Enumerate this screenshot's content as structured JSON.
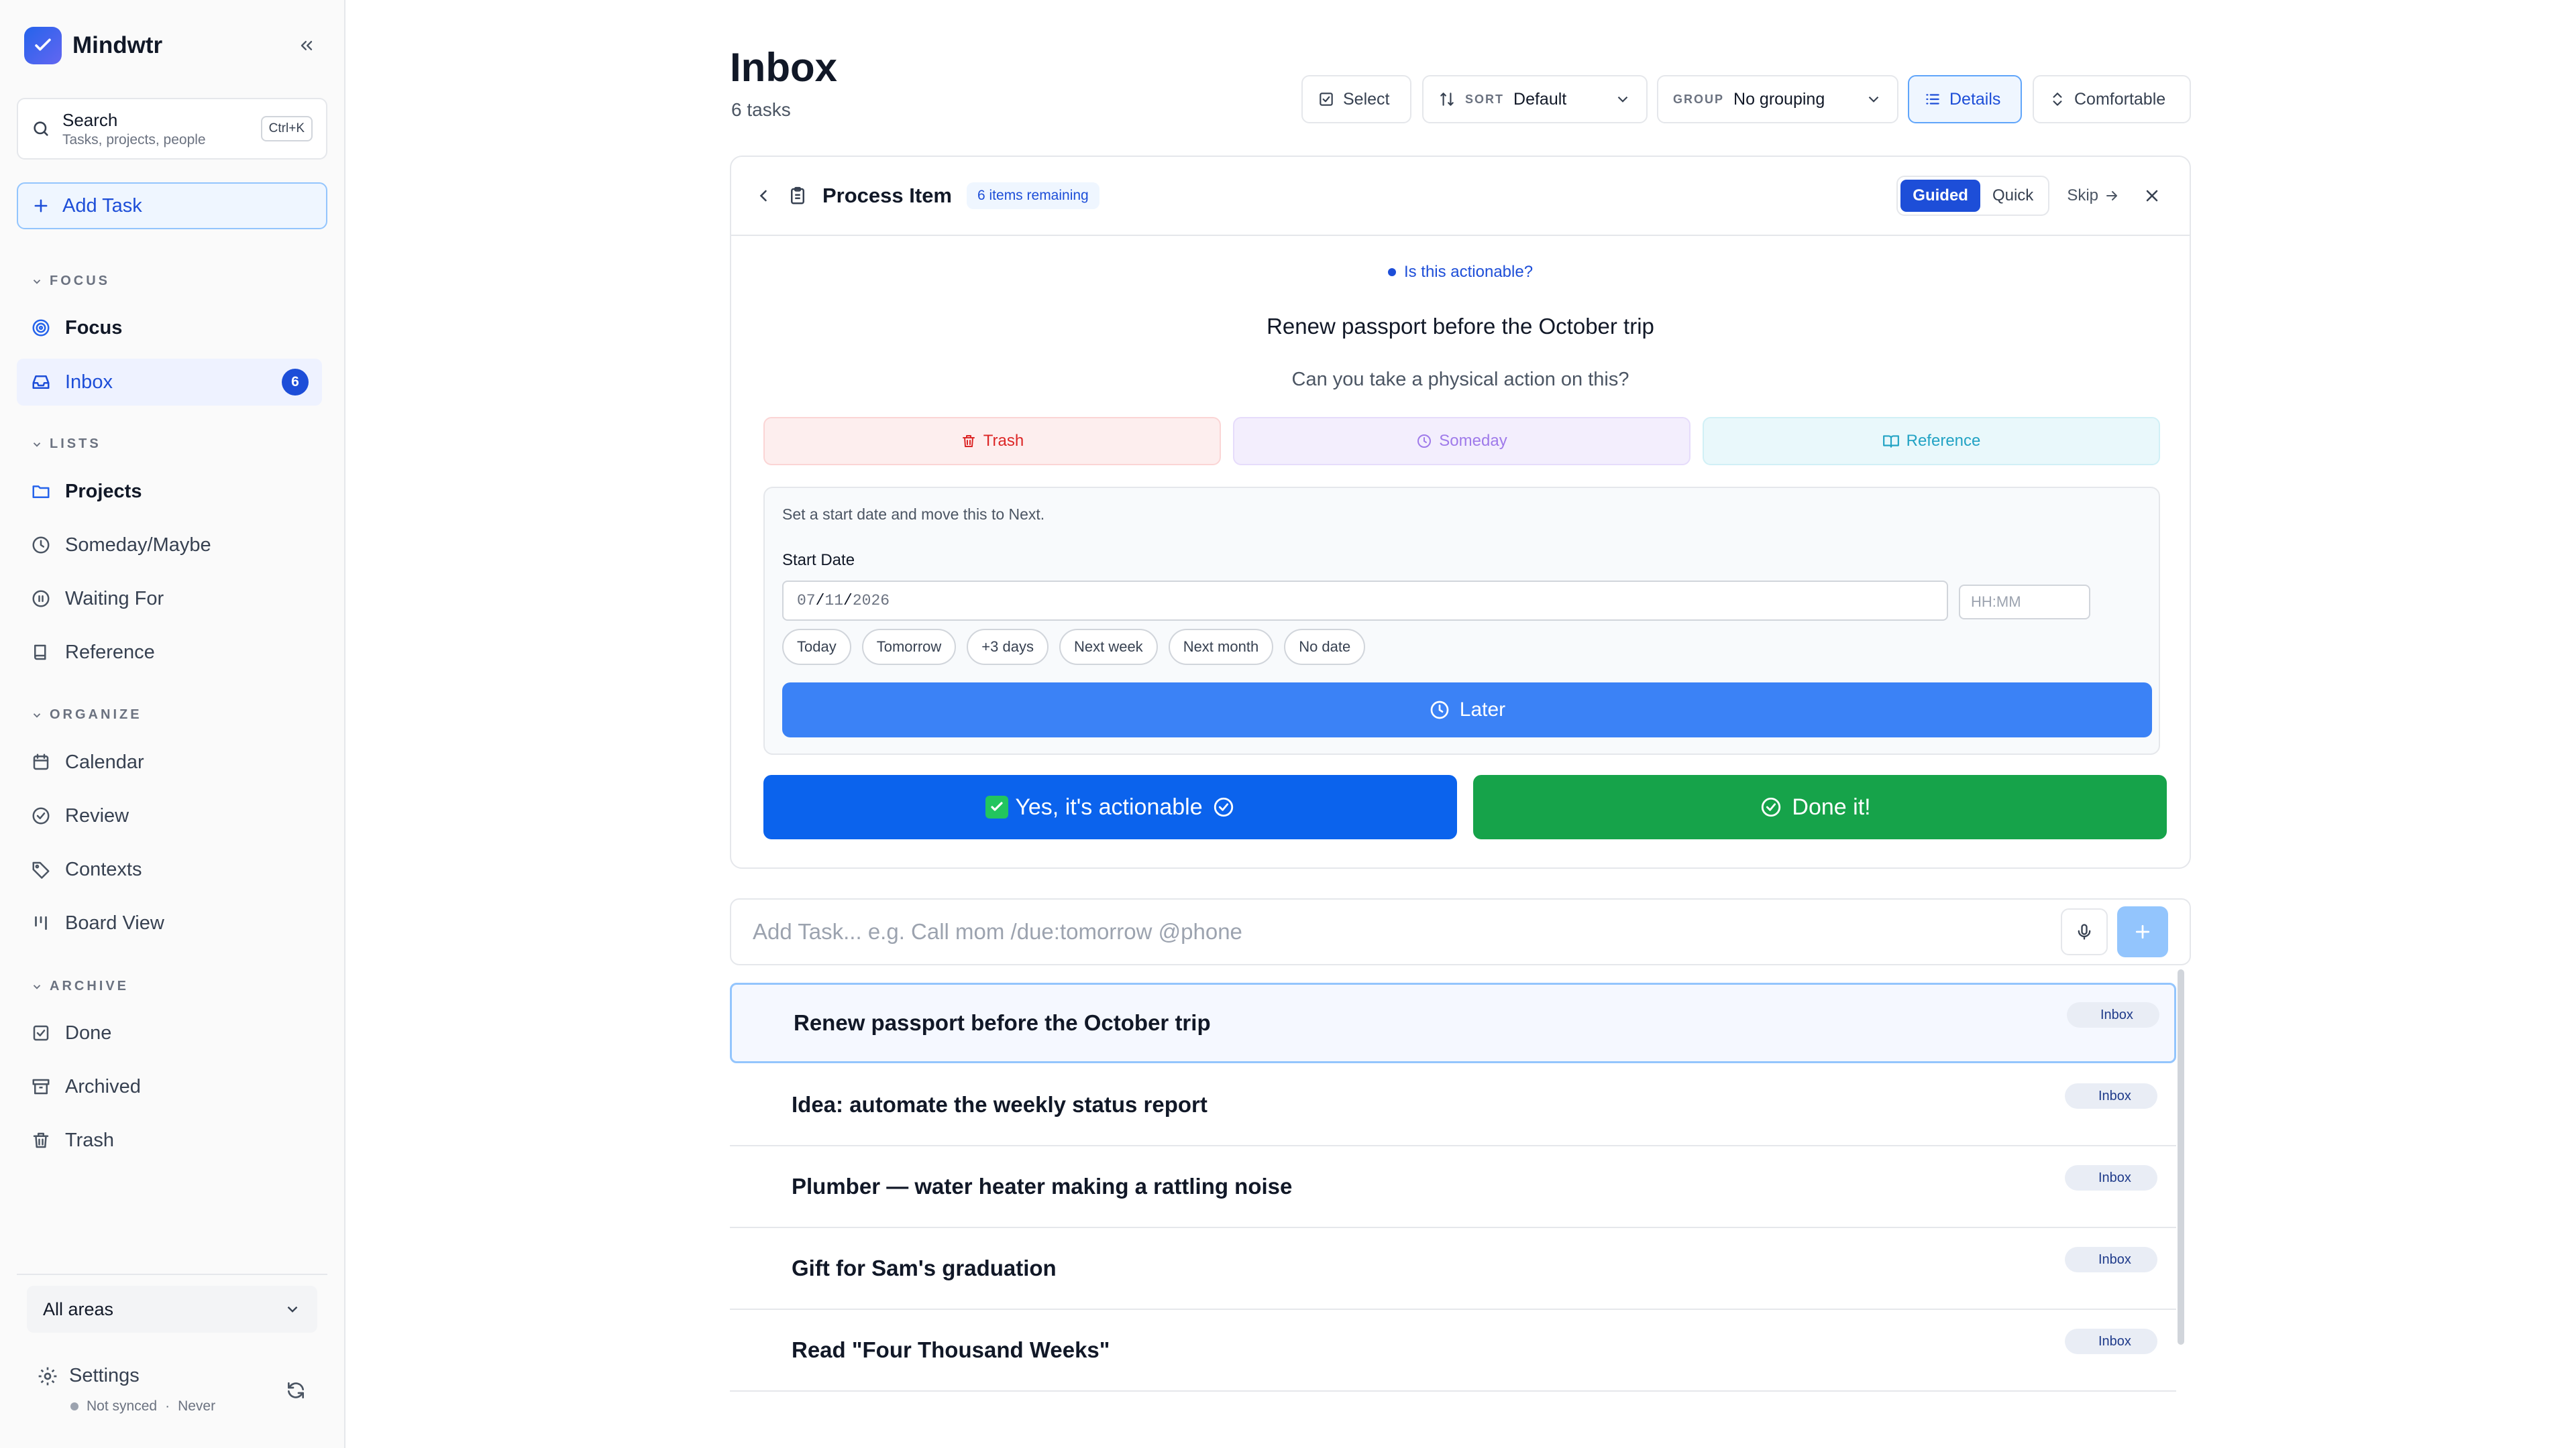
{
  "app": {
    "name": "Mindwtr",
    "accent": "#1d4ed8"
  },
  "sidebar": {
    "search": {
      "title": "Search",
      "subtitle": "Tasks, projects, people",
      "shortcut": "Ctrl+K"
    },
    "add_task_label": "Add Task",
    "sections": {
      "focus": "FOCUS",
      "lists": "LISTS",
      "organize": "ORGANIZE",
      "archive": "ARCHIVE"
    },
    "items": {
      "focus": {
        "label": "Focus",
        "icon": "target-icon"
      },
      "inbox": {
        "label": "Inbox",
        "icon": "inbox-icon",
        "badge": "6"
      },
      "projects": {
        "label": "Projects",
        "icon": "folder-icon"
      },
      "someday": {
        "label": "Someday/Maybe",
        "icon": "clock-icon"
      },
      "waiting": {
        "label": "Waiting For",
        "icon": "pause-icon"
      },
      "reference": {
        "label": "Reference",
        "icon": "book-icon"
      },
      "calendar": {
        "label": "Calendar",
        "icon": "calendar-icon"
      },
      "review": {
        "label": "Review",
        "icon": "check-circle-icon"
      },
      "contexts": {
        "label": "Contexts",
        "icon": "tag-icon"
      },
      "board": {
        "label": "Board View",
        "icon": "columns-icon"
      },
      "done": {
        "label": "Done",
        "icon": "check-square-icon"
      },
      "archived": {
        "label": "Archived",
        "icon": "archive-icon"
      },
      "trash": {
        "label": "Trash",
        "icon": "trash-icon"
      }
    },
    "area_select": "All areas",
    "settings": {
      "label": "Settings",
      "sync_status": "Not synced",
      "sync_time": "Never"
    }
  },
  "main": {
    "title": "Inbox",
    "count": "6 tasks",
    "toolbar": {
      "select": "Select",
      "sort_label": "SORT",
      "sort_value": "Default",
      "group_label": "GROUP",
      "group_value": "No grouping",
      "details": "Details",
      "density": "Comfortable"
    }
  },
  "process": {
    "title": "Process Item",
    "remaining": "6 items remaining",
    "mode_guided": "Guided",
    "mode_quick": "Quick",
    "skip": "Skip",
    "step": "Is this actionable?",
    "item_title": "Renew passport before the October trip",
    "question": "Can you take a physical action on this?",
    "choices": {
      "trash": "Trash",
      "someday": "Someday",
      "reference": "Reference"
    },
    "later": {
      "hint": "Set a start date and move this to Next.",
      "start_date_label": "Start Date",
      "date_month": "07",
      "date_day": "11",
      "date_year": "2026",
      "time_placeholder": "HH:MM",
      "quick_dates": [
        "Today",
        "Tomorrow",
        "+3 days",
        "Next week",
        "Next month",
        "No date"
      ],
      "button": "Later"
    },
    "yes_label": "Yes, it's actionable",
    "done_label": "Done it!"
  },
  "quick_add": {
    "placeholder": "Add Task... e.g. Call mom /due:tomorrow @phone"
  },
  "tasks": [
    {
      "title": "Renew passport before the October trip",
      "tag": "Inbox"
    },
    {
      "title": "Idea: automate the weekly status report",
      "tag": "Inbox"
    },
    {
      "title": "Plumber — water heater making a rattling noise",
      "tag": "Inbox"
    },
    {
      "title": "Gift for Sam's graduation",
      "tag": "Inbox"
    },
    {
      "title": "Read \"Four Thousand Weeks\"",
      "tag": "Inbox"
    }
  ]
}
